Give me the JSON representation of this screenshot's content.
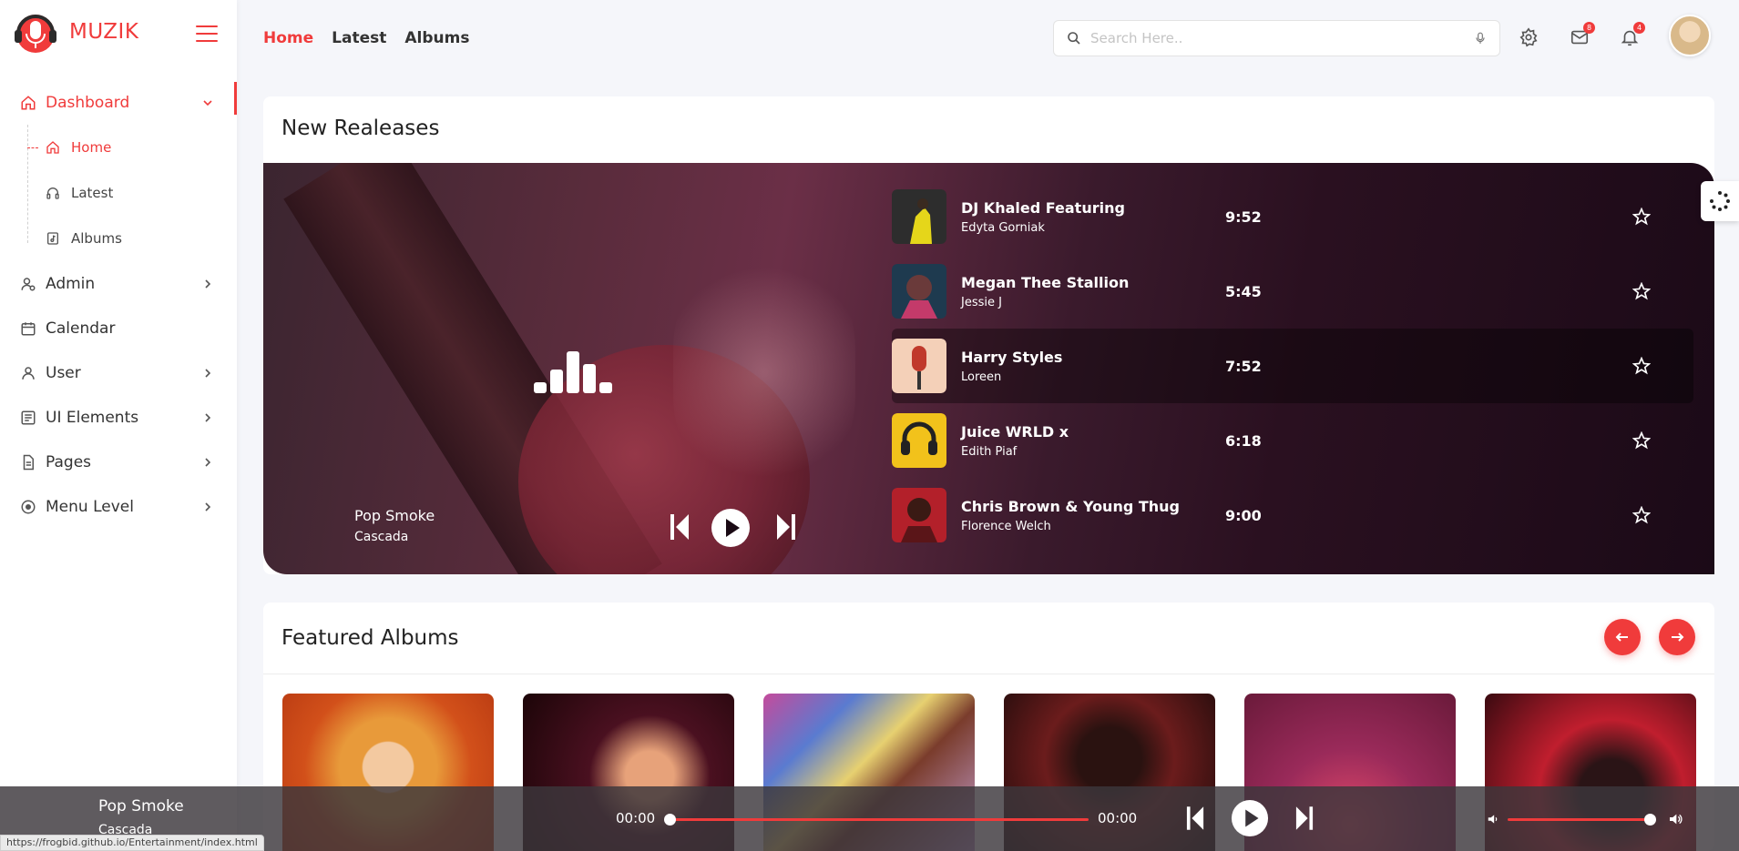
{
  "brand": {
    "name": "MUZIK"
  },
  "sidebar": {
    "dashboard": "Dashboard",
    "sub": [
      {
        "label": "Home",
        "icon": "home-icon"
      },
      {
        "label": "Latest",
        "icon": "headphones-icon"
      },
      {
        "label": "Albums",
        "icon": "album-icon"
      }
    ],
    "items": [
      {
        "label": "Admin",
        "icon": "admin-icon"
      },
      {
        "label": "Calendar",
        "icon": "calendar-icon"
      },
      {
        "label": "User",
        "icon": "user-icon"
      },
      {
        "label": "UI Elements",
        "icon": "ui-elements-icon"
      },
      {
        "label": "Pages",
        "icon": "pages-icon"
      },
      {
        "label": "Menu Level",
        "icon": "menu-level-icon"
      }
    ]
  },
  "header": {
    "nav": [
      "Home",
      "Latest",
      "Albums"
    ],
    "search_placeholder": "Search Here..",
    "mail_badge": "8",
    "bell_badge": "4"
  },
  "releases": {
    "title": "New Realeases",
    "now_playing": {
      "title": "Pop Smoke",
      "artist": "Cascada"
    },
    "tracks": [
      {
        "name": "DJ Khaled Featuring",
        "artist": "Edyta Gorniak",
        "duration": "9:52"
      },
      {
        "name": "Megan Thee Stallion",
        "artist": "Jessie J",
        "duration": "5:45"
      },
      {
        "name": "Harry Styles",
        "artist": "Loreen",
        "duration": "7:52"
      },
      {
        "name": "Juice WRLD x",
        "artist": "Edith Piaf",
        "duration": "6:18"
      },
      {
        "name": "Chris Brown & Young Thug",
        "artist": "Florence Welch",
        "duration": "9:00"
      }
    ]
  },
  "featured": {
    "title": "Featured Albums"
  },
  "player": {
    "title": "Pop Smoke",
    "artist": "Cascada",
    "time_current": "00:00",
    "time_total": "00:00",
    "progress": 0,
    "volume": 0.98
  },
  "status_url": "https://frogbid.github.io/Entertainment/index.html",
  "colors": {
    "accent": "#f03b3b",
    "background": "#f5f6fa"
  }
}
